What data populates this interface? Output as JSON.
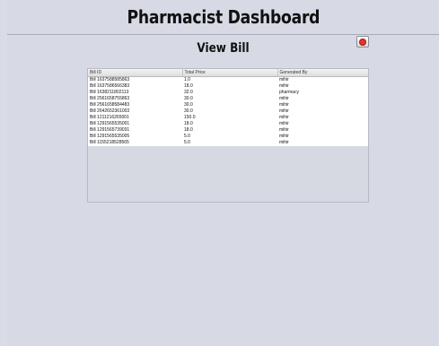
{
  "header": {
    "title": "Pharmacist Dashboard"
  },
  "page": {
    "subtitle": "View Bill"
  },
  "table": {
    "columns": [
      "Bill ID",
      "Total Price",
      "Generated By"
    ],
    "rows": [
      [
        "Bill 1637588585863",
        "1.0",
        "mihir"
      ],
      [
        "Bill 1637586566383",
        "18.0",
        "mihir"
      ],
      [
        "Bill 1638211802113",
        "32.0",
        "pharmacy"
      ],
      [
        "Bill 2561658755863",
        "30.0",
        "mihir"
      ],
      [
        "Bill 2561658584483",
        "30.0",
        "mihir"
      ],
      [
        "Bill 2642652361003",
        "30.0",
        "mihir"
      ],
      [
        "Bill 1211216265001",
        "150.0",
        "mihir"
      ],
      [
        "Bill 1291565535001",
        "18.0",
        "mihir"
      ],
      [
        "Bill 1291565739031",
        "18.0",
        "mihir"
      ],
      [
        "Bill 1291565535005",
        "5.0",
        "mihir"
      ],
      [
        "Bill 1155218528565",
        "5.0",
        "mihir"
      ]
    ]
  },
  "colors": {
    "background": "#d9dce6",
    "close_button": "#e0382c"
  },
  "icons": {
    "close": "close-icon"
  }
}
